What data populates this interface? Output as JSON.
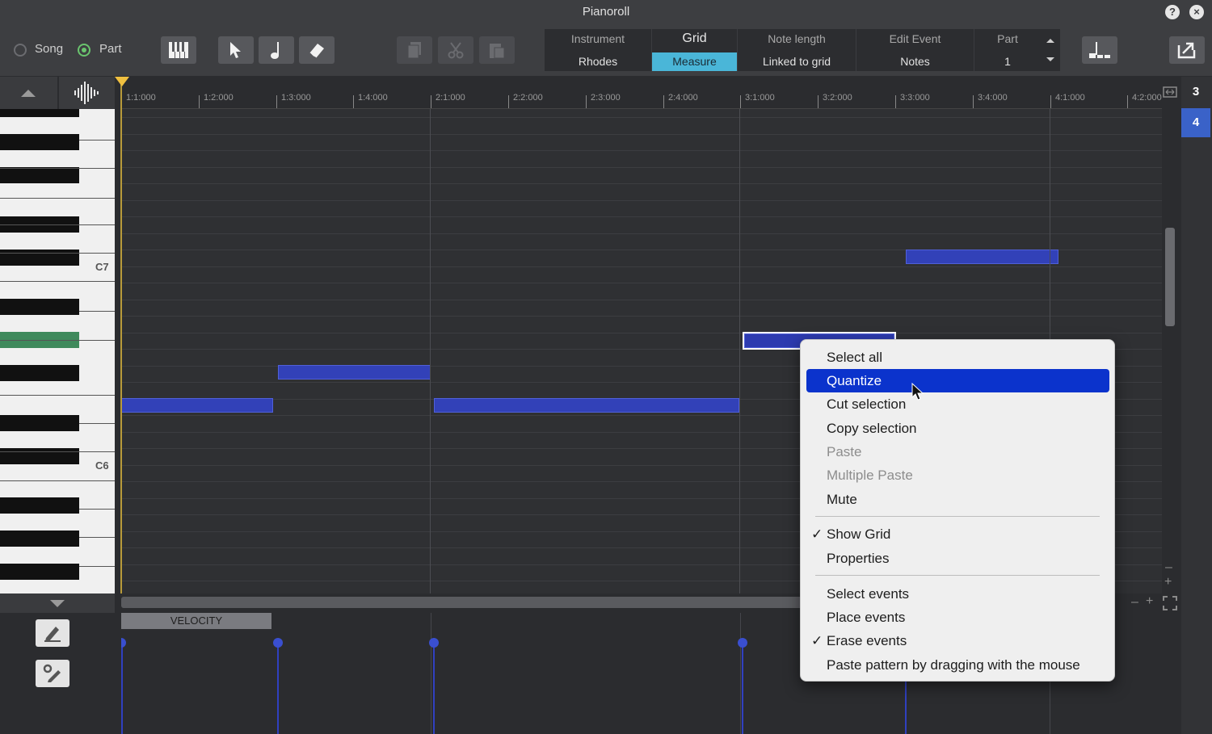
{
  "window": {
    "title": "Pianoroll"
  },
  "mode": {
    "song_label": "Song",
    "part_label": "Part",
    "selected": "Part"
  },
  "info": {
    "instrument_label": "Instrument",
    "instrument_value": "Rhodes",
    "grid_label": "Grid",
    "grid_value": "Measure",
    "note_length_label": "Note length",
    "note_length_value": "Linked to grid",
    "edit_event_label": "Edit Event",
    "edit_event_value": "Notes",
    "part_label": "Part",
    "part_value": "1"
  },
  "ruler": {
    "labels": [
      "1:1:000",
      "1:2:000",
      "1:3:000",
      "1:4:000",
      "2:1:000",
      "2:2:000",
      "2:3:000",
      "2:4:000",
      "3:1:000",
      "3:2:000",
      "3:3:000",
      "3:4:000",
      "4:1:000",
      "4:2:000"
    ]
  },
  "keyboard": {
    "c7": "C7",
    "c6": "C6"
  },
  "tracks": [
    "3",
    "4"
  ],
  "velocity": {
    "label": "VELOCITY"
  },
  "menu": {
    "items": [
      {
        "label": "Select all",
        "state": "normal"
      },
      {
        "label": "Quantize",
        "state": "highlighted"
      },
      {
        "label": "Cut selection",
        "state": "normal"
      },
      {
        "label": "Copy selection",
        "state": "normal"
      },
      {
        "label": "Paste",
        "state": "disabled"
      },
      {
        "label": "Multiple Paste",
        "state": "disabled"
      },
      {
        "label": "Mute",
        "state": "normal"
      },
      {
        "label": "Show Grid",
        "state": "checked"
      },
      {
        "label": "Properties",
        "state": "normal"
      },
      {
        "label": "Select events",
        "state": "normal"
      },
      {
        "label": "Place events",
        "state": "normal"
      },
      {
        "label": "Erase events",
        "state": "checked"
      },
      {
        "label": "Paste pattern by dragging with the mouse",
        "state": "normal"
      }
    ],
    "check_glyph": "✓"
  },
  "colors": {
    "note": "#3241b8",
    "highlight": "#0b33cc",
    "grid_value_bg": "#4ab6d8",
    "active_track": "#3a62c8",
    "playhead": "#f0c040"
  }
}
